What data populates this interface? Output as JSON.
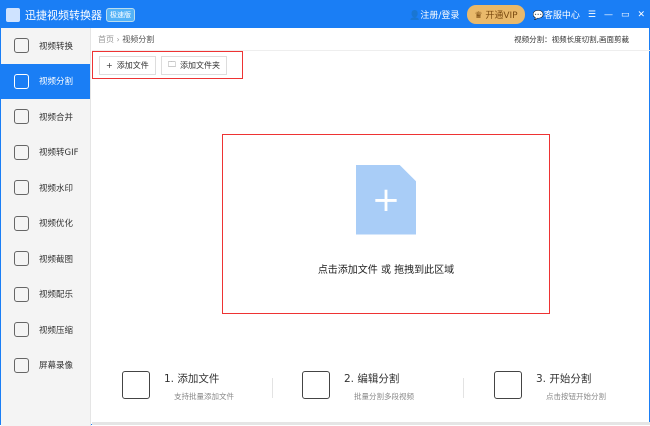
{
  "titlebar": {
    "title": "迅捷视频转换器",
    "edition": "极速版",
    "login": "注册/登录",
    "vip": "开通VIP",
    "service": "客服中心"
  },
  "sidebar": {
    "items": [
      {
        "label": "视频转换"
      },
      {
        "label": "视频分割"
      },
      {
        "label": "视频合并"
      },
      {
        "label": "视频转GIF"
      },
      {
        "label": "视频水印"
      },
      {
        "label": "视频优化"
      },
      {
        "label": "视频截图"
      },
      {
        "label": "视频配乐"
      },
      {
        "label": "视频压缩"
      },
      {
        "label": "屏幕录像"
      }
    ],
    "active": 1
  },
  "breadcrumb": {
    "home": "首页",
    "sep": "›",
    "current": "视频分割"
  },
  "hint": "视频分割：视频长度切割,画面剪裁",
  "toolbar": {
    "add_file": "添加文件",
    "add_folder": "添加文件夹"
  },
  "drop": {
    "text": "点击添加文件 或 拖拽到此区域"
  },
  "steps": [
    {
      "title": "1. 添加文件",
      "desc": "支持批量添加文件"
    },
    {
      "title": "2. 编辑分割",
      "desc": "批量分割多段视频"
    },
    {
      "title": "3. 开始分割",
      "desc": "点击按钮开始分割"
    }
  ]
}
